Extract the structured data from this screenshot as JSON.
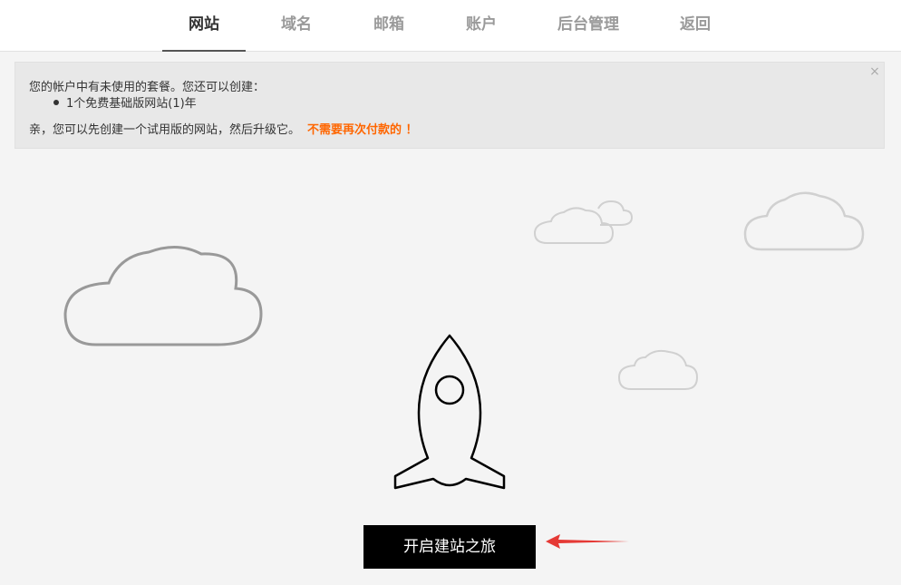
{
  "nav": {
    "tabs": [
      {
        "label": "网站",
        "active": true
      },
      {
        "label": "域名",
        "active": false
      },
      {
        "label": "邮箱",
        "active": false
      },
      {
        "label": "账户",
        "active": false
      },
      {
        "label": "后台管理",
        "active": false
      },
      {
        "label": "返回",
        "active": false
      }
    ]
  },
  "notice": {
    "close_label": "×",
    "line1": "您的帐户中有未使用的套餐。您还可以创建：",
    "bullet": "1个免费基础版网站(1)年",
    "line3": "亲，您可以先创建一个试用版的网站，然后升级它。",
    "highlight": "不需要再次付款的 ！"
  },
  "cta": {
    "label": "开启建站之旅"
  },
  "icons": {
    "rocket": "rocket-icon",
    "cloud": "cloud-icon",
    "arrow": "red-arrow-icon",
    "close": "close-icon"
  },
  "colors": {
    "highlight": "#ff6600",
    "arrow": "#e53935",
    "button_bg": "#000000",
    "background": "#f4f4f4"
  }
}
